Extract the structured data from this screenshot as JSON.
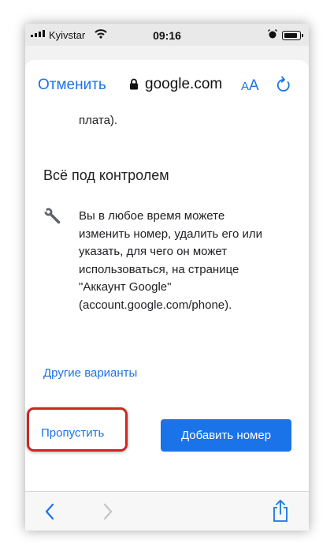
{
  "status_bar": {
    "carrier": "Kyivstar",
    "time": "09:16",
    "icons": [
      "signal-icon",
      "wifi-icon",
      "alarm-icon",
      "battery-icon"
    ]
  },
  "nav_bar": {
    "cancel_label": "Отменить",
    "url": "google.com",
    "text_size_label_small": "A",
    "text_size_label_large": "A",
    "icons": [
      "lock-icon",
      "reload-icon"
    ]
  },
  "content": {
    "fragment_text": "плата).",
    "section_title": "Всё под контролем",
    "section_icon": "wrench-icon",
    "description_lines": [
      "Вы в любое время можете",
      "изменить номер, удалить его или",
      "указать, для чего он может",
      "использоваться, на странице",
      "\"Аккаунт Google\"",
      "(account.google.com/phone)."
    ],
    "other_options_link": "Другие варианты"
  },
  "actions": {
    "skip_label": "Пропустить",
    "add_number_label": "Добавить номер",
    "accent_color": "#1a73e8",
    "highlight_color": "#d02424"
  },
  "toolbar": {
    "icons": [
      "back-icon",
      "forward-icon",
      "share-icon"
    ]
  }
}
